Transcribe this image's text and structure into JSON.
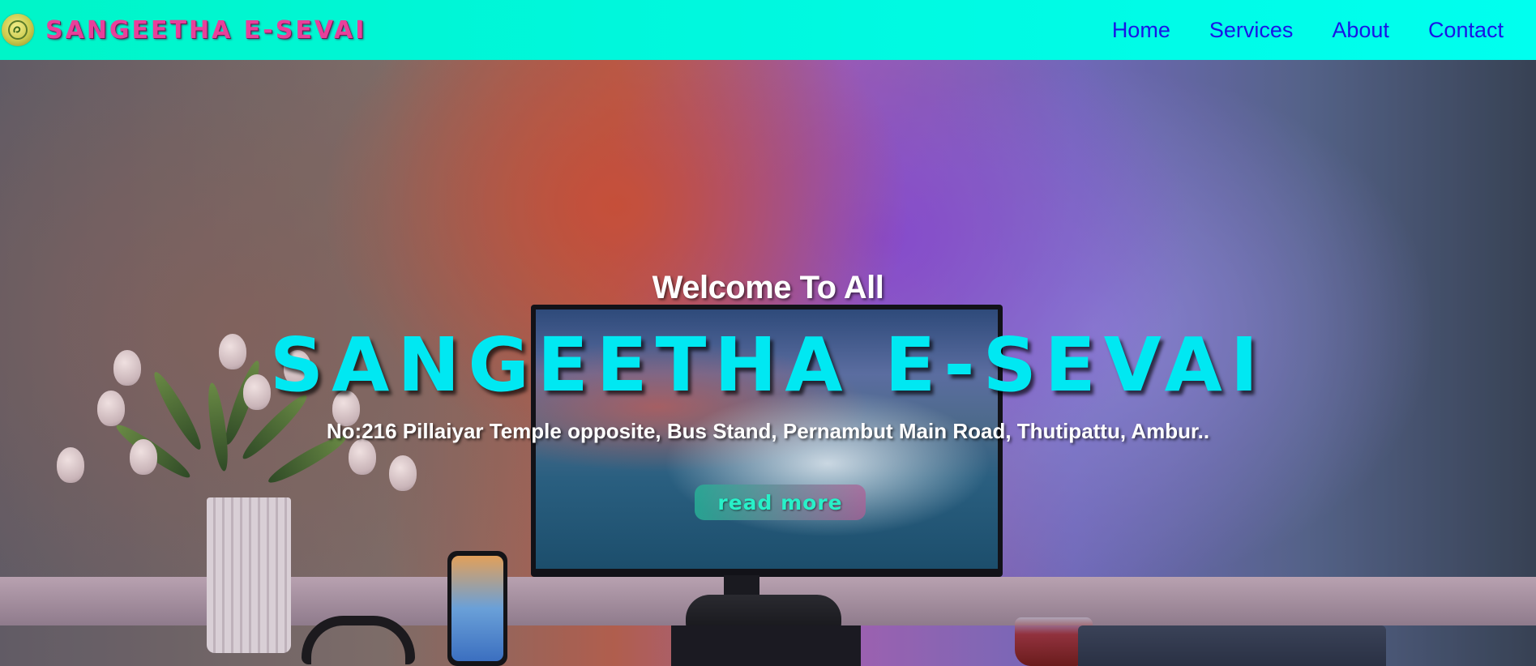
{
  "brand": {
    "name": "SANGEETHA E-SEVAI",
    "logo_icon": "om-logo-icon"
  },
  "nav": {
    "items": [
      {
        "label": "Home"
      },
      {
        "label": "Services"
      },
      {
        "label": "About"
      },
      {
        "label": "Contact"
      }
    ]
  },
  "hero": {
    "welcome": "Welcome To All",
    "title": "SANGEETHA E-SEVAI",
    "address": "No:216 Pillaiyar Temple opposite, Bus Stand, Pernambut Main Road, Thutipattu, Ambur..",
    "cta_label": "read more"
  },
  "colors": {
    "navbar": "#00f5d4",
    "brand_text": "#e8409a",
    "nav_link": "#1a14e6",
    "hero_title": "#00e8f2",
    "cta_text": "#28f0c8"
  }
}
